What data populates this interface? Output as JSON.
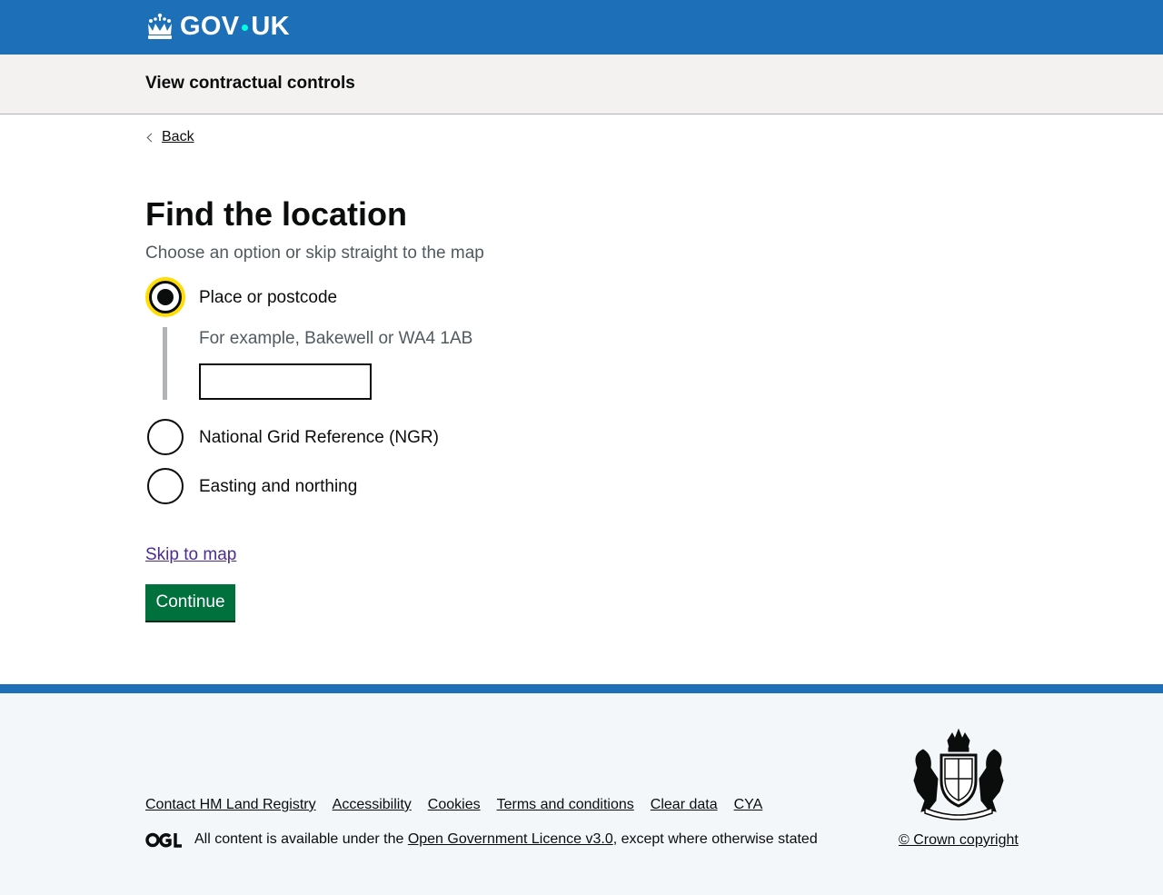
{
  "header": {
    "logo_text_left": "GOV",
    "logo_text_right": "UK",
    "logo_icon": "crown-icon"
  },
  "service": {
    "name": "View contractual controls"
  },
  "nav": {
    "back_label": "Back"
  },
  "main": {
    "title": "Find the location",
    "hint": "Choose an option or skip straight to the map",
    "options": [
      {
        "label": "Place or postcode",
        "selected": true
      },
      {
        "label": "National Grid Reference (NGR)",
        "selected": false
      },
      {
        "label": "Easting and northing",
        "selected": false
      }
    ],
    "conditional": {
      "hint": "For example, Bakewell or WA4 1AB",
      "value": ""
    },
    "skip_link": "Skip to map",
    "continue_label": "Continue"
  },
  "footer": {
    "links": [
      "Contact HM Land Registry",
      "Accessibility",
      "Cookies",
      "Terms and conditions",
      "Clear data",
      "CYA"
    ],
    "licence_prefix": "All content is available under the ",
    "licence_link": "Open Government Licence v3.0",
    "licence_suffix": ", except where otherwise stated",
    "copyright": "© Crown copyright",
    "crest_icon": "royal-coat-of-arms-icon",
    "ogl_icon": "ogl-logo-icon"
  },
  "colors": {
    "header_blue": "#1d70b8",
    "button_green": "#00703c",
    "focus_yellow": "#ffdd00",
    "link_visited": "#4c2c92"
  }
}
